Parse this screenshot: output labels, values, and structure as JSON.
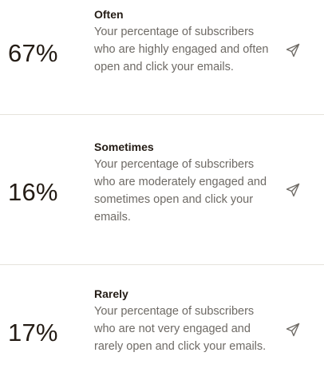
{
  "engagement": {
    "rows": [
      {
        "percent": "67%",
        "label": "Often",
        "description": "Your percentage of subscribers who are highly engaged and often open and click your emails.",
        "icon": "send-icon"
      },
      {
        "percent": "16%",
        "label": "Sometimes",
        "description": "Your percentage of subscribers who are moderately engaged and sometimes open and click your emails.",
        "icon": "send-icon"
      },
      {
        "percent": "17%",
        "label": "Rarely",
        "description": "Your percentage of subscribers who are not very engaged and rarely open and click your emails.",
        "icon": "send-icon"
      }
    ]
  },
  "colors": {
    "text_primary": "#241c15",
    "text_secondary": "#6e6a65",
    "divider": "#e6e3dc",
    "icon": "#6e6a65"
  }
}
